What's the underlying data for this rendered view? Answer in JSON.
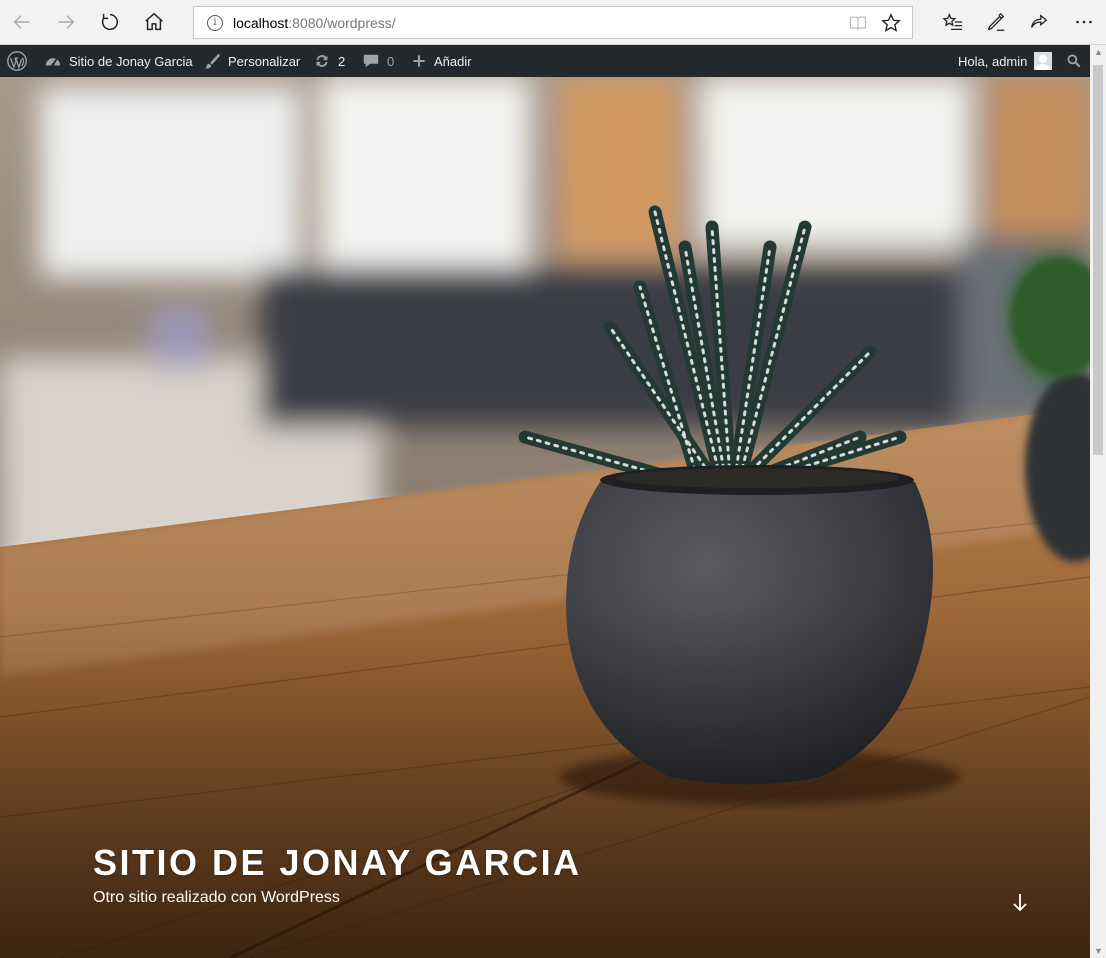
{
  "browser": {
    "url_host": "localhost",
    "url_rest": ":8080/wordpress/",
    "info_glyph": "i"
  },
  "adminbar": {
    "wp_logo_icon": "wordpress-logo-icon",
    "site_name": "Sitio de Jonay Garcia",
    "customize": "Personalizar",
    "updates_count": "2",
    "comments_count": "0",
    "new": "Añadir",
    "greeting": "Hola, admin"
  },
  "hero": {
    "title": "SITIO DE JONAY GARCIA",
    "description": "Otro sitio realizado con WordPress"
  },
  "colors": {
    "adminbar_bg": "#23282d",
    "browser_bg": "#f2f2f2"
  }
}
